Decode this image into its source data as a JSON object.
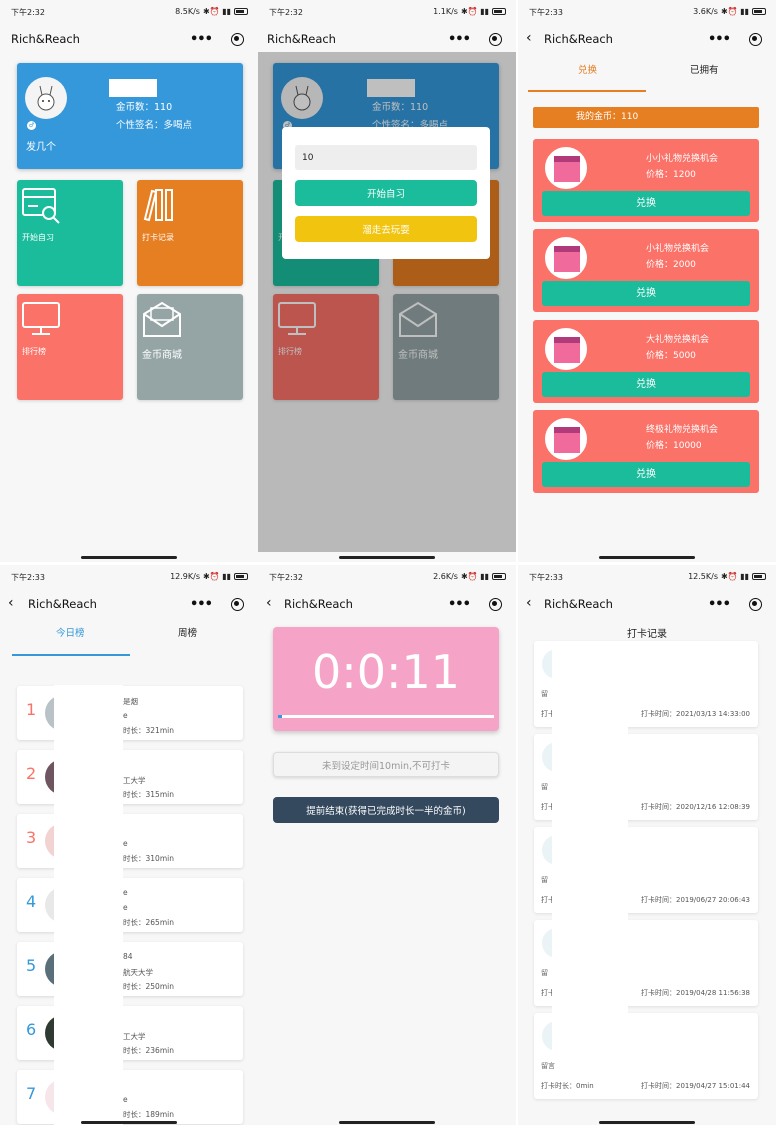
{
  "status": [
    {
      "time": "下午2:32",
      "net": "8.5K/s"
    },
    {
      "time": "下午2:32",
      "net": "1.1K/s"
    },
    {
      "time": "下午2:33",
      "net": "3.6K/s"
    },
    {
      "time": "下午2:33",
      "net": "12.9K/s"
    },
    {
      "time": "下午2:32",
      "net": "2.6K/s"
    },
    {
      "time": "下午2:33",
      "net": "12.5K/s"
    }
  ],
  "app_title": "Rich&Reach",
  "home": {
    "nickname": "发几个",
    "coins": "金币数：110",
    "signature": "个性签名：多喝点",
    "tiles": [
      "开始自习",
      "打卡记录",
      "排行榜",
      "金币商城"
    ]
  },
  "dialog": {
    "input_value": "10",
    "start": "开始自习",
    "leave": "溜走去玩耍"
  },
  "shop": {
    "tabs": [
      "兑换",
      "已拥有"
    ],
    "my_coins": "我的金币：110",
    "gifts": [
      {
        "name": "小小礼物兑换机会",
        "price": "价格：1200",
        "btn": "兑换"
      },
      {
        "name": "小礼物兑换机会",
        "price": "价格：2000",
        "btn": "兑换"
      },
      {
        "name": "大礼物兑换机会",
        "price": "价格：5000",
        "btn": "兑换"
      },
      {
        "name": "终极礼物兑换机会",
        "price": "价格：10000",
        "btn": "兑换"
      }
    ]
  },
  "ranking": {
    "tabs": [
      "今日榜",
      "周榜"
    ],
    "rows": [
      {
        "rank": "1",
        "l1": "是烟",
        "l2": "e",
        "l3": "时长：321min"
      },
      {
        "rank": "2",
        "l1": "",
        "l2": "工大学",
        "l3": "时长：315min"
      },
      {
        "rank": "3",
        "l1": "",
        "l2": "e",
        "l3": "时长：310min"
      },
      {
        "rank": "4",
        "l1": "e",
        "l2": "e",
        "l3": "时长：265min"
      },
      {
        "rank": "5",
        "l1": "84",
        "l2": "航天大学",
        "l3": "时长：250min"
      },
      {
        "rank": "6",
        "l1": "",
        "l2": "工大学",
        "l3": "时长：236min"
      },
      {
        "rank": "7",
        "l1": "",
        "l2": "e",
        "l3": "时长：189min"
      }
    ]
  },
  "timer": {
    "value": "0:0:11",
    "progress": 0.02,
    "checkin": "未到设定时间10min,不可打卡",
    "finish": "提前结束(获得已完成时长一半的金币)"
  },
  "records": {
    "title": "打卡记录",
    "items": [
      {
        "msg": "留",
        "dur": "打卡",
        "time": "打卡时间：2021/03/13 14:33:00"
      },
      {
        "msg": "留",
        "dur": "打卡",
        "time": "打卡时间：2020/12/16 12:08:39"
      },
      {
        "msg": "留",
        "dur": "打卡",
        "time": "打卡时间：2019/06/27 20:06:43"
      },
      {
        "msg": "留",
        "dur": "打卡",
        "time": "打卡时间：2019/04/28 11:56:38"
      },
      {
        "msg": "留言",
        "dur": "打卡时长：0min",
        "time": "打卡时间：2019/04/27 15:01:44"
      }
    ]
  },
  "colors": {
    "blue": "#3498db",
    "teal": "#1abc9c",
    "orange": "#e67e22",
    "salmon": "#fa7268",
    "gray": "#95a5a6",
    "yellow": "#f1c40f",
    "pink": "#f5a3c7",
    "navy": "#34495e"
  }
}
